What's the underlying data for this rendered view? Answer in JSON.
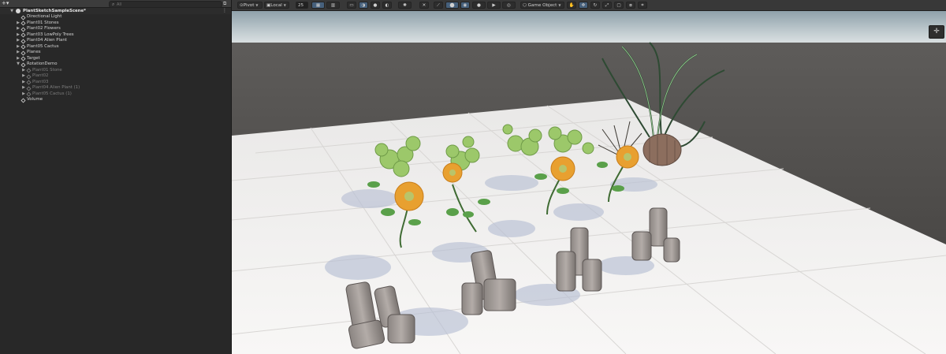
{
  "hierarchy": {
    "add_label": "+▾",
    "search_placeholder": "All",
    "scene_name": "PlantSketchSampleScene*",
    "items": [
      {
        "label": "Directional Light",
        "depth": 1,
        "expandable": false,
        "dim": false
      },
      {
        "label": "Plant01 Stones",
        "depth": 1,
        "expandable": true,
        "dim": false
      },
      {
        "label": "Plant02 Flowers",
        "depth": 1,
        "expandable": true,
        "dim": false
      },
      {
        "label": "Plant03 LowPoly Trees",
        "depth": 1,
        "expandable": true,
        "dim": false
      },
      {
        "label": "Plant04 Alien Plant",
        "depth": 1,
        "expandable": true,
        "dim": false
      },
      {
        "label": "Plant05 Cactus",
        "depth": 1,
        "expandable": true,
        "dim": false
      },
      {
        "label": "Planes",
        "depth": 1,
        "expandable": true,
        "dim": false
      },
      {
        "label": "Target",
        "depth": 1,
        "expandable": true,
        "dim": false
      },
      {
        "label": "RotationDemo",
        "depth": 1,
        "expandable": true,
        "expanded": true,
        "dim": false
      },
      {
        "label": "Plant01 Stone",
        "depth": 2,
        "expandable": true,
        "dim": true
      },
      {
        "label": "Plant02",
        "depth": 2,
        "expandable": true,
        "dim": true
      },
      {
        "label": "Plant03",
        "depth": 2,
        "expandable": true,
        "dim": true
      },
      {
        "label": "Plant04 Alien Plant (1)",
        "depth": 2,
        "expandable": true,
        "dim": true
      },
      {
        "label": "Plant05 Cactus (1)",
        "depth": 2,
        "expandable": true,
        "dim": true
      },
      {
        "label": "Volume",
        "depth": 1,
        "expandable": false,
        "dim": false
      }
    ]
  },
  "scene_toolbar": {
    "pivot_label": "Pivot",
    "local_label": "Local",
    "snap_value": "25",
    "game_object_label": "Game Object"
  },
  "colors": {
    "sky_top": "#93a4ad",
    "horizon": "#d3dadd",
    "ground_far": "#4a4846",
    "floor": "#f2f0ee",
    "selection_blue": "#46607c"
  }
}
